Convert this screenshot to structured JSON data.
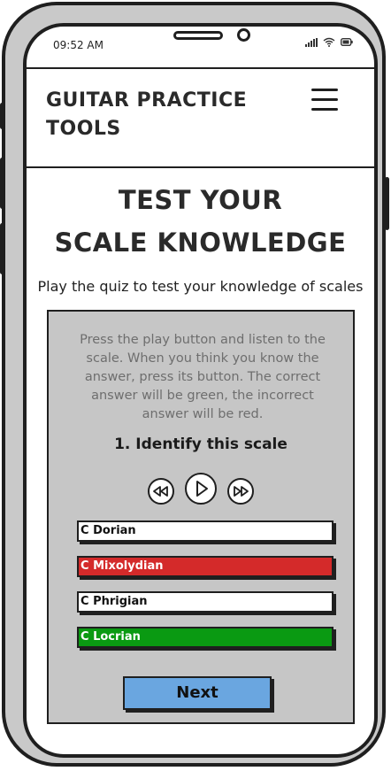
{
  "status_bar": {
    "time": "09:52 AM",
    "icons": [
      "signal-icon",
      "wifi-icon",
      "battery-icon"
    ]
  },
  "header": {
    "brand_line1": "GUITAR PRACTICE",
    "brand_line2": "TOOLS",
    "menu_icon": "hamburger-icon"
  },
  "main": {
    "title_line1": "TEST YOUR",
    "title_line2": "SCALE KNOWLEDGE",
    "subtitle": "Play the quiz to test your knowledge of scales"
  },
  "quiz": {
    "instructions": "Press the play button and listen to the scale. When you think you know the answer, press its button. The correct answer will be green, the incorrect answer will be red.",
    "question": "1. Identify this scale",
    "controls": [
      "rewind-icon",
      "play-icon",
      "fast-forward-icon"
    ],
    "answers": [
      {
        "label": "C Dorian",
        "state": "neutral",
        "color": "#ffffff",
        "text_color": "#111111"
      },
      {
        "label": "C Mixolydian",
        "state": "incorrect",
        "color": "#d42a2a",
        "text_color": "#ffffff"
      },
      {
        "label": "C Phrigian",
        "state": "neutral",
        "color": "#ffffff",
        "text_color": "#111111"
      },
      {
        "label": "C Locrian",
        "state": "correct",
        "color": "#0a9a12",
        "text_color": "#ffffff"
      }
    ],
    "next_label": "Next"
  },
  "colors": {
    "panel": "#c6c6c6",
    "next_button": "#6aa6e0",
    "correct": "#0a9a12",
    "incorrect": "#d42a2a"
  }
}
